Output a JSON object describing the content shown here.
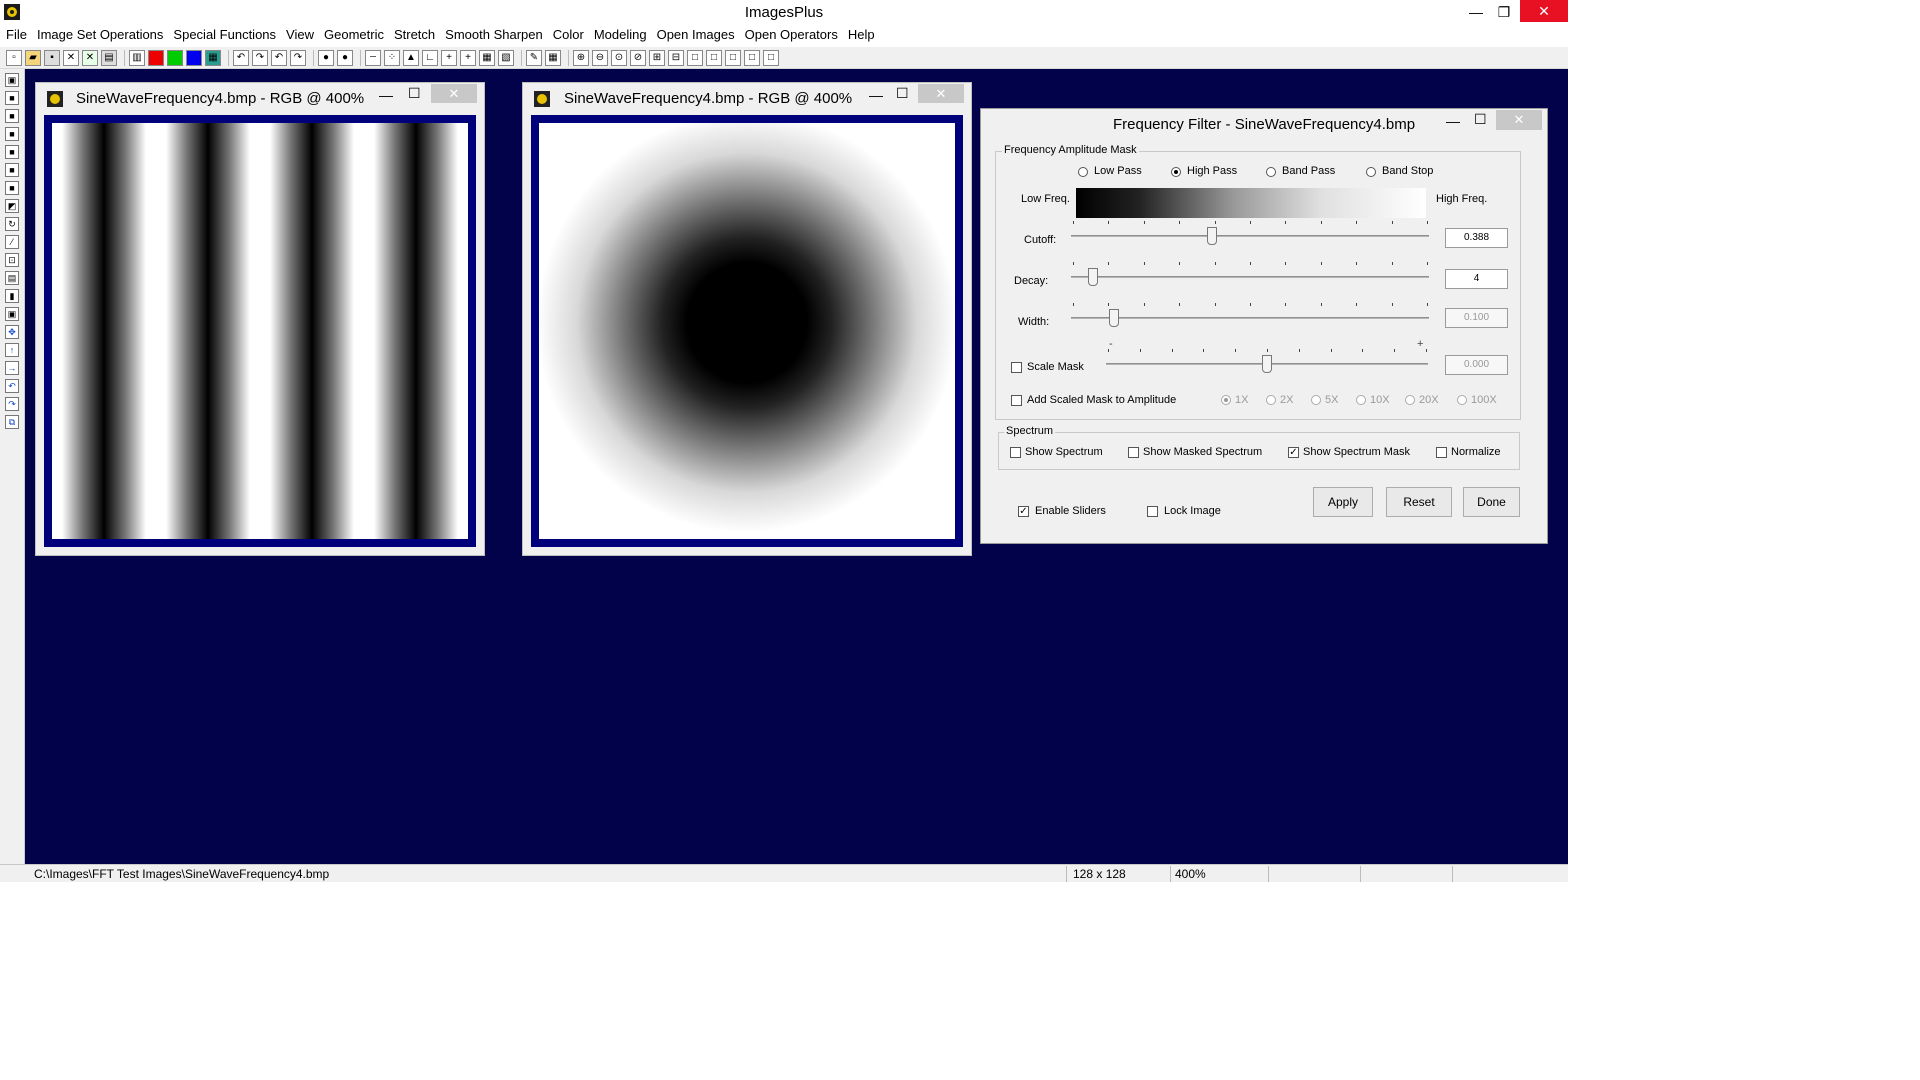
{
  "app": {
    "title": "ImagesPlus",
    "minimize": "—",
    "maximize": "❐",
    "close": "✕"
  },
  "menu": [
    "File",
    "Image Set Operations",
    "Special Functions",
    "View",
    "Geometric",
    "Stretch",
    "Smooth Sharpen",
    "Color",
    "Modeling",
    "Open Images",
    "Open Operators",
    "Help"
  ],
  "windows": {
    "left": {
      "title": "SineWaveFrequency4.bmp - RGB @ 400%"
    },
    "right": {
      "title": "SineWaveFrequency4.bmp - RGB @ 400%"
    }
  },
  "dialog": {
    "title": "Frequency Filter - SineWaveFrequency4.bmp",
    "amplitude_group": "Frequency Amplitude Mask",
    "filters": [
      "Low Pass",
      "High Pass",
      "Band Pass",
      "Band Stop"
    ],
    "selected_filter": "High Pass",
    "low_freq_label": "Low Freq.",
    "high_freq_label": "High Freq.",
    "sliders": {
      "cutoff": {
        "label": "Cutoff:",
        "value": "0.388",
        "fraction": 0.39
      },
      "decay": {
        "label": "Decay:",
        "value": "4",
        "fraction": 0.05
      },
      "width": {
        "label": "Width:",
        "value": "0.100",
        "fraction": 0.11
      },
      "scale": {
        "label": "Scale Mask",
        "value": "0.000",
        "fraction": 0.5,
        "min_mark": "-",
        "max_mark": "+"
      }
    },
    "add_scaled_label": "Add Scaled Mask to Amplitude",
    "multipliers": [
      "1X",
      "2X",
      "5X",
      "10X",
      "20X",
      "100X"
    ],
    "selected_multiplier": "1X",
    "spectrum_group": "Spectrum",
    "spectrum_options": [
      {
        "label": "Show Spectrum",
        "checked": false
      },
      {
        "label": "Show Masked Spectrum",
        "checked": false
      },
      {
        "label": "Show Spectrum Mask",
        "checked": true
      },
      {
        "label": "Normalize",
        "checked": false
      }
    ],
    "enable_sliders": {
      "label": "Enable Sliders",
      "checked": true
    },
    "lock_image": {
      "label": "Lock Image",
      "checked": false
    },
    "buttons": {
      "apply": "Apply",
      "reset": "Reset",
      "done": "Done"
    }
  },
  "status": {
    "path": "C:\\Images\\FFT Test Images\\SineWaveFrequency4.bmp",
    "size": "128 x 128",
    "zoom": "400%"
  },
  "colors": {
    "workspace": "#02024a",
    "frame": "#00007a"
  }
}
